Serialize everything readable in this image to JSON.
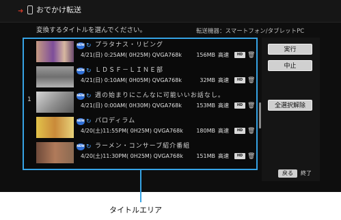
{
  "header": {
    "title": "おでかけ転送",
    "arrow": "➜",
    "icon_name": "phone-icon"
  },
  "instruction": "変換するタイトルを選んでください。",
  "device": "転送機器：スマートフォン/タブレットPC",
  "list_label": "タイトルエリア",
  "accent_color": "#36a4e6",
  "programs": [
    {
      "num": "",
      "title": "プラタナス・リビング",
      "info": "4/21(日) 0:25AM( 0H25M) QVGA768k",
      "size": "156MB",
      "mode": "高速",
      "hd": "HD"
    },
    {
      "num": "",
      "title": "ＬＤＳＦ－ＬＩＮＥ部",
      "info": "4/21(日) 0:10AM( 0H05M) QVGA768k",
      "size": "32MB",
      "mode": "高速",
      "hd": "HD"
    },
    {
      "num": "1",
      "title": "週の始まりにこんなに可能いいお話なし。",
      "info": "4/21(日) 0:00AM( 0H30M) QVGA768k",
      "size": "153MB",
      "mode": "高速",
      "hd": "HD"
    },
    {
      "num": "",
      "title": "パロディラム",
      "info": "4/20(土)11:55PM( 0H25M) QVGA768k",
      "size": "180MB",
      "mode": "高速",
      "hd": "HD"
    },
    {
      "num": "",
      "title": "ラーメン・コンサーブ紹介番組",
      "info": "4/20(土)11:30PM( 0H25M) QVGA768k",
      "size": "151MB",
      "mode": "高速",
      "hd": "HD"
    }
  ],
  "buttons": {
    "execute": "実行",
    "cancel": "中止",
    "deselect_all": "全選択解除"
  },
  "footer": {
    "back_button": "戻る",
    "back_text": "終了"
  }
}
